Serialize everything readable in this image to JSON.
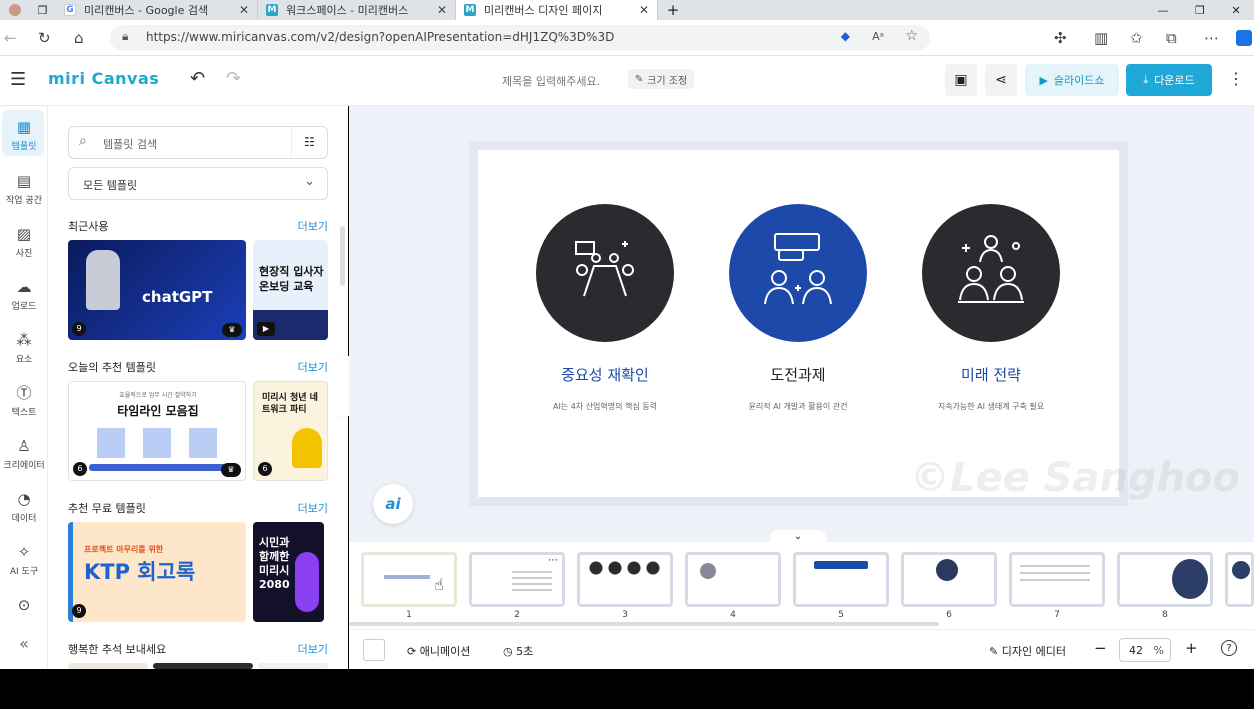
{
  "browser": {
    "tabs": [
      {
        "label": "미리캔버스 - Google 검색",
        "favicon": "G",
        "color": "#4285f4"
      },
      {
        "label": "워크스페이스 - 미리캔버스",
        "favicon": "M",
        "color": "#2aa3c7"
      },
      {
        "label": "미리캔버스 디자인 페이지",
        "favicon": "M",
        "color": "#2aa3c7"
      }
    ],
    "url": "https://www.miricanvas.com/v2/design?openAIPresentation=dHJ1ZQ%3D%3D"
  },
  "header": {
    "logo": "miri Canvas",
    "title_placeholder": "제목을 입력해주세요.",
    "resize_label": "크기 조정",
    "slideshow_label": "슬라이드쇼",
    "download_label": "다운로드"
  },
  "rail": [
    {
      "label": "템플릿",
      "icon": "template-icon"
    },
    {
      "label": "작업 공간",
      "icon": "workspace-icon"
    },
    {
      "label": "사진",
      "icon": "photo-icon"
    },
    {
      "label": "업로드",
      "icon": "upload-icon"
    },
    {
      "label": "요소",
      "icon": "elements-icon"
    },
    {
      "label": "텍스트",
      "icon": "text-icon"
    },
    {
      "label": "크리에이터",
      "icon": "creator-icon"
    },
    {
      "label": "데이터",
      "icon": "data-icon"
    },
    {
      "label": "AI 도구",
      "icon": "ai-tools-icon"
    }
  ],
  "panel": {
    "search_placeholder": "템플릿 검색",
    "category": "모든 템플릿",
    "more": "더보기",
    "sections": [
      {
        "title": "최근사용",
        "cards": [
          {
            "text": "chatGPT",
            "count": "9"
          },
          {
            "text": "현장직 입사자 온보딩 교육"
          }
        ]
      },
      {
        "title": "오늘의 추천 템플릿",
        "cards": [
          {
            "text": "타임라인 모음집",
            "subtext": "효율적으로 업무 시간 절약하기",
            "count": "6"
          },
          {
            "text": "미리시 청년 네트워크 파티",
            "count": "6"
          }
        ]
      },
      {
        "title": "추천 무료 템플릿",
        "cards": [
          {
            "text": "KTP 회고록",
            "subtext": "프로젝트 마무리를 위한",
            "count": "9"
          },
          {
            "text": "시민과 함께한 미리시 2080"
          }
        ]
      },
      {
        "title": "행복한 추석 보내세요",
        "cards": []
      }
    ]
  },
  "slide": {
    "items": [
      {
        "title": "중요성 재확인",
        "desc": "AI는 4차 산업혁명의 핵심 동력",
        "circle_color": "#2a2b2f",
        "title_color": "#1d4aa8"
      },
      {
        "title": "도전과제",
        "desc": "윤리적 AI 개발과 활용이 관건",
        "circle_color": "#1d4aa8",
        "title_color": "#222222"
      },
      {
        "title": "미래 전략",
        "desc": "지속가능한 AI 생태계 구축 필요",
        "circle_color": "#2a2b2f",
        "title_color": "#1d4aa8"
      }
    ]
  },
  "thumbs": [
    "1",
    "2",
    "3",
    "4",
    "5",
    "6",
    "7",
    "8"
  ],
  "bottom": {
    "animation_label": "애니메이션",
    "timer_label": "5초",
    "design_editor_label": "디자인 에디터",
    "zoom": "42",
    "zoom_unit": "%"
  },
  "watermark": "©Lee Sanghoon"
}
